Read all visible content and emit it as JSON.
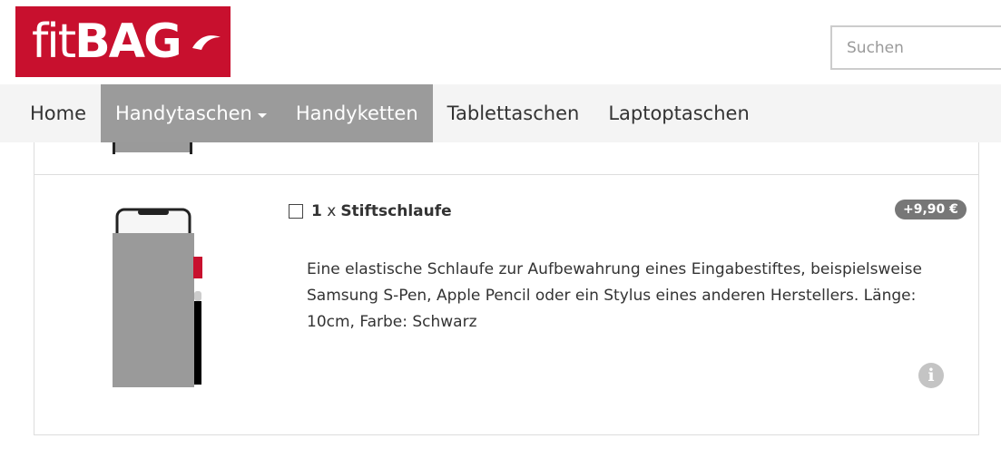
{
  "logo": {
    "fit": "fit",
    "bag": "BAG"
  },
  "search": {
    "placeholder": "Suchen"
  },
  "nav": {
    "items": [
      {
        "label": "Home"
      },
      {
        "label": "Handytaschen"
      },
      {
        "label": "Handyketten"
      },
      {
        "label": "Tablettaschen"
      },
      {
        "label": "Laptoptaschen"
      }
    ]
  },
  "option": {
    "quantity": "1",
    "times": "x",
    "name": "Stiftschlaufe",
    "price": "+9,90 €",
    "description": "Eine elastische Schlaufe zur Aufbewahrung eines Eingabestiftes, beispielsweise Samsung S-Pen, Apple Pencil oder ein Stylus eines anderen Herstellers. Länge: 10cm, Farbe: Schwarz",
    "info_glyph": "i"
  },
  "colors": {
    "brand_red": "#c8102e",
    "nav_active": "#9b9b9b",
    "nav_bg": "#f4f4f4",
    "badge": "#777777"
  },
  "icons": [
    "fitbag-logo",
    "caret-down-icon",
    "checkbox-icon",
    "info-icon",
    "phone-case-product-image"
  ]
}
